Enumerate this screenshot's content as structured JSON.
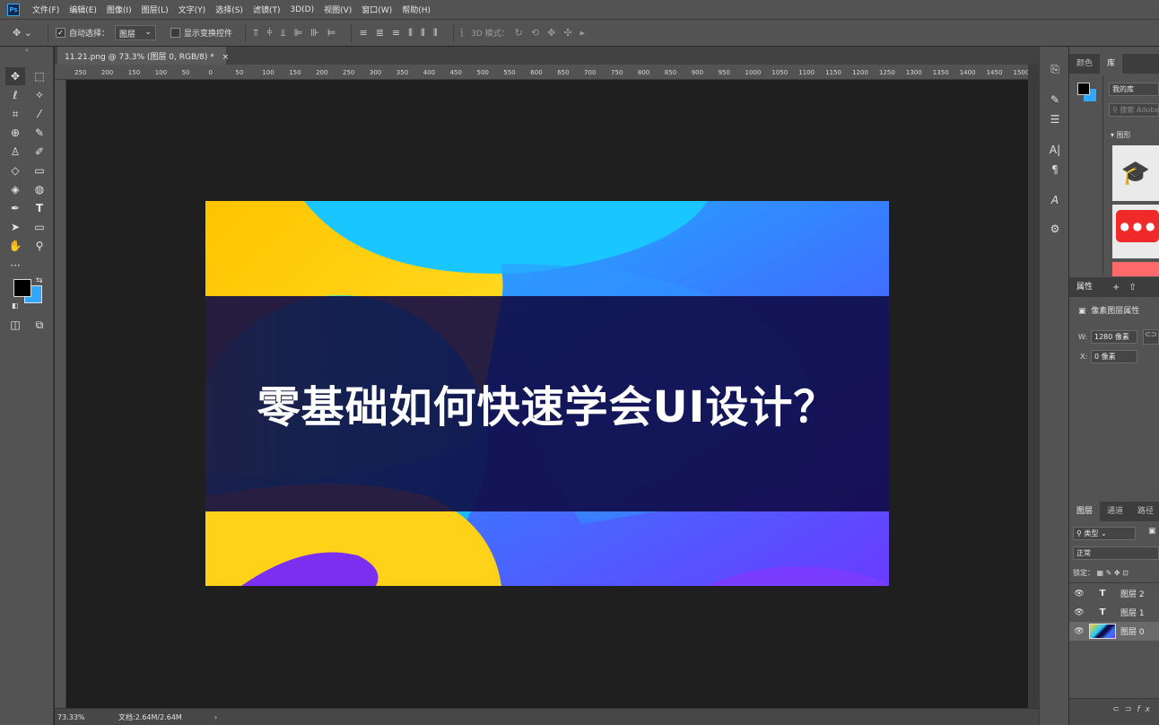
{
  "app": {
    "logo_text": "Ps"
  },
  "menu": [
    "文件(F)",
    "编辑(E)",
    "图像(I)",
    "图层(L)",
    "文字(Y)",
    "选择(S)",
    "滤镜(T)",
    "3D(D)",
    "视图(V)",
    "窗口(W)",
    "帮助(H)"
  ],
  "options": {
    "auto_select_label": "自动选择：",
    "auto_select_value": "图层",
    "show_transform_label": "显示变换控件",
    "mode_3d_label": "3D 模式："
  },
  "document": {
    "tab_title": "11.21.png @ 73.3% (图层 0, RGB/8) *",
    "headline": "零基础如何快速学会UI设计？"
  },
  "ruler_top": [
    "250",
    "200",
    "150",
    "100",
    "50",
    "0",
    "50",
    "100",
    "150",
    "200",
    "250",
    "300",
    "350",
    "400",
    "450",
    "500",
    "550",
    "600",
    "650",
    "700",
    "750",
    "800",
    "850",
    "900",
    "950",
    "1000",
    "1050",
    "1100",
    "1150",
    "1200",
    "1250",
    "1300",
    "1350",
    "1400",
    "1450",
    "1500"
  ],
  "status": {
    "zoom": "73.33%",
    "doc_info": "文档:2.64M/2.64M"
  },
  "panels": {
    "color_tab": "颜色",
    "library_tab": "库",
    "library_select": "我的库",
    "library_search_placeholder": "搜索 Adobe Stock",
    "library_section": "图形",
    "props_tab": "属性",
    "props_title": "像素图层属性",
    "w_label": "W:",
    "w_value": "1280 像素",
    "x_label": "X:",
    "x_value": "0 像素",
    "layers_tab": "图层",
    "channels_tab": "通道",
    "paths_tab": "路径",
    "filter_kind": "类型",
    "blend_mode": "正常",
    "lock_label": "锁定：",
    "layers": [
      {
        "name": "图层 2",
        "kind": "T"
      },
      {
        "name": "图层 1",
        "kind": "T"
      },
      {
        "name": "图层 0",
        "kind": "img"
      }
    ]
  },
  "colors": {
    "foreground": "#000000",
    "background": "#31a8ff",
    "accent": "#31a8ff"
  }
}
